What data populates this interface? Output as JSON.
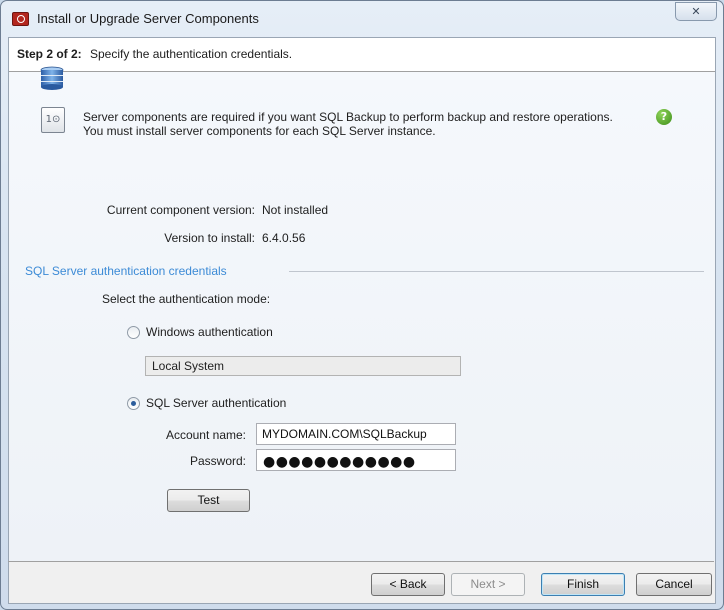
{
  "window": {
    "title": "Install or Upgrade Server Components",
    "close_glyph": "✕"
  },
  "header": {
    "step": "Step 2 of 2:",
    "description": "Specify the authentication credentials."
  },
  "info": {
    "line1": "Server components are required if you want SQL Backup to perform backup and restore operations.",
    "line2": "You must install server components for each SQL Server instance.",
    "component_icon_text": "1⊙"
  },
  "versions": {
    "current_label": "Current component version:",
    "current_value": "Not installed",
    "install_label": "Version to install:",
    "install_value": "6.4.0.56"
  },
  "credentials": {
    "group_title": "SQL Server authentication credentials",
    "mode_prompt": "Select the authentication mode:",
    "windows_label": "Windows authentication",
    "windows_account": "Local System",
    "sql_label": "SQL Server authentication",
    "selected_mode": "sql",
    "account_label": "Account name:",
    "account_value": "MYDOMAIN.COM\\SQLBackup",
    "password_label": "Password:",
    "password_mask": "●●●●●●●●●●●●",
    "test_label": "Test"
  },
  "buttons": {
    "back": "< Back",
    "next": "Next >",
    "finish": "Finish",
    "cancel": "Cancel"
  },
  "icons": {
    "app": "red-backup-app-icon",
    "db": "database-stack-icon",
    "component": "server-component-icon",
    "help": "help-question-icon"
  },
  "colors": {
    "group_title": "#3c8bd6",
    "help_icon": "#3d8d19",
    "app_icon": "#b3261e"
  }
}
